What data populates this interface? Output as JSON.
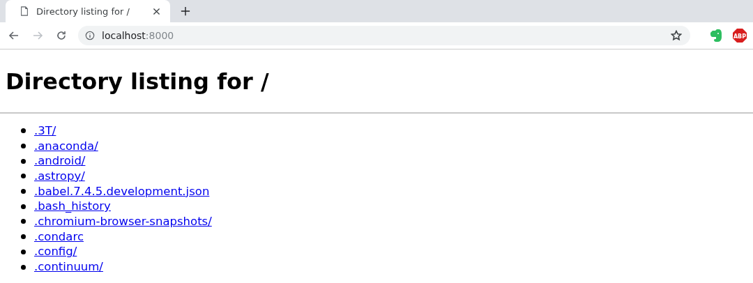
{
  "tabs": [
    {
      "title": "Directory listing for /",
      "selected": true
    }
  ],
  "address_bar": {
    "host": "localhost",
    "port": ":8000"
  },
  "extensions": [
    {
      "kind": "elephant"
    },
    {
      "kind": "stop-sign",
      "label": "ABP"
    }
  ],
  "page": {
    "heading": "Directory listing for /",
    "entries": [
      ".3T/",
      ".anaconda/",
      ".android/",
      ".astropy/",
      ".babel.7.4.5.development.json",
      ".bash_history",
      ".chromium-browser-snapshots/",
      ".condarc",
      ".config/",
      ".continuum/"
    ]
  }
}
